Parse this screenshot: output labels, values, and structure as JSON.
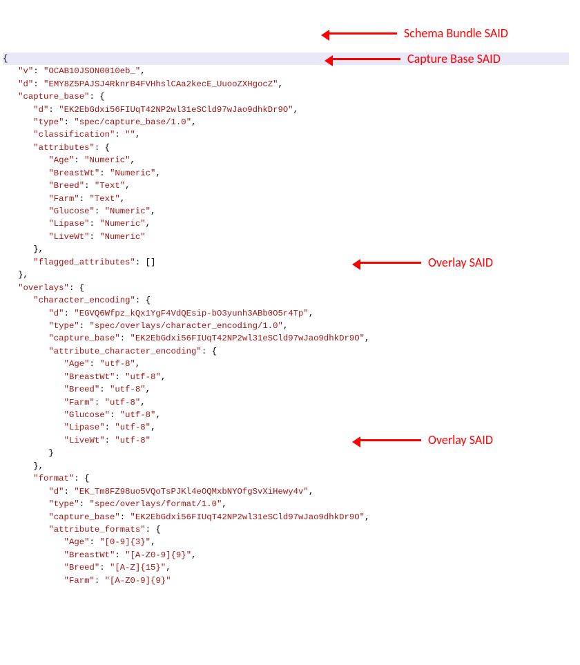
{
  "json": {
    "v": "OCAB10JSON0010eb_",
    "d": "EMY8Z5PAJSJ4RknrB4FVHhslCAa2kecE_UuooZXHgocZ",
    "capture_base": {
      "d": "EK2EbGdxi56FIUqT42NP2wl31eSCld97wJao9dhkDr9O",
      "type": "spec/capture_base/1.0",
      "classification": "",
      "attributes": {
        "Age": "Numeric",
        "BreastWt": "Numeric",
        "Breed": "Text",
        "Farm": "Text",
        "Glucose": "Numeric",
        "Lipase": "Numeric",
        "LiveWt": "Numeric"
      },
      "flagged_attributes": "[]"
    },
    "overlays": {
      "character_encoding": {
        "d": "EGVQ6Wfpz_kQx1YgF4VdQEsip-bO3yunh3ABb0O5r4Tp",
        "type": "spec/overlays/character_encoding/1.0",
        "capture_base": "EK2EbGdxi56FIUqT42NP2wl31eSCld97wJao9dhkDr9O",
        "attribute_character_encoding": {
          "Age": "utf-8",
          "BreastWt": "utf-8",
          "Breed": "utf-8",
          "Farm": "utf-8",
          "Glucose": "utf-8",
          "Lipase": "utf-8",
          "LiveWt": "utf-8"
        }
      },
      "format": {
        "d": "EK_Tm8FZ98uo5VQoTsPJKl4eOQMxbNYOfgSvXiHewy4v",
        "type": "spec/overlays/format/1.0",
        "capture_base": "EK2EbGdxi56FIUqT42NP2wl31eSCld97wJao9dhkDr9O",
        "attribute_formats": {
          "Age": "[0-9]{3}",
          "BreastWt": "[A-Z0-9]{9}",
          "Breed": "[A-Z]{15}",
          "Farm": "[A-Z0-9]{9}"
        }
      }
    }
  },
  "annotations": {
    "a1": "Schema Bundle SAID",
    "a2": "Capture Base SAID",
    "a3": "Overlay SAID",
    "a4": "Overlay SAID"
  }
}
